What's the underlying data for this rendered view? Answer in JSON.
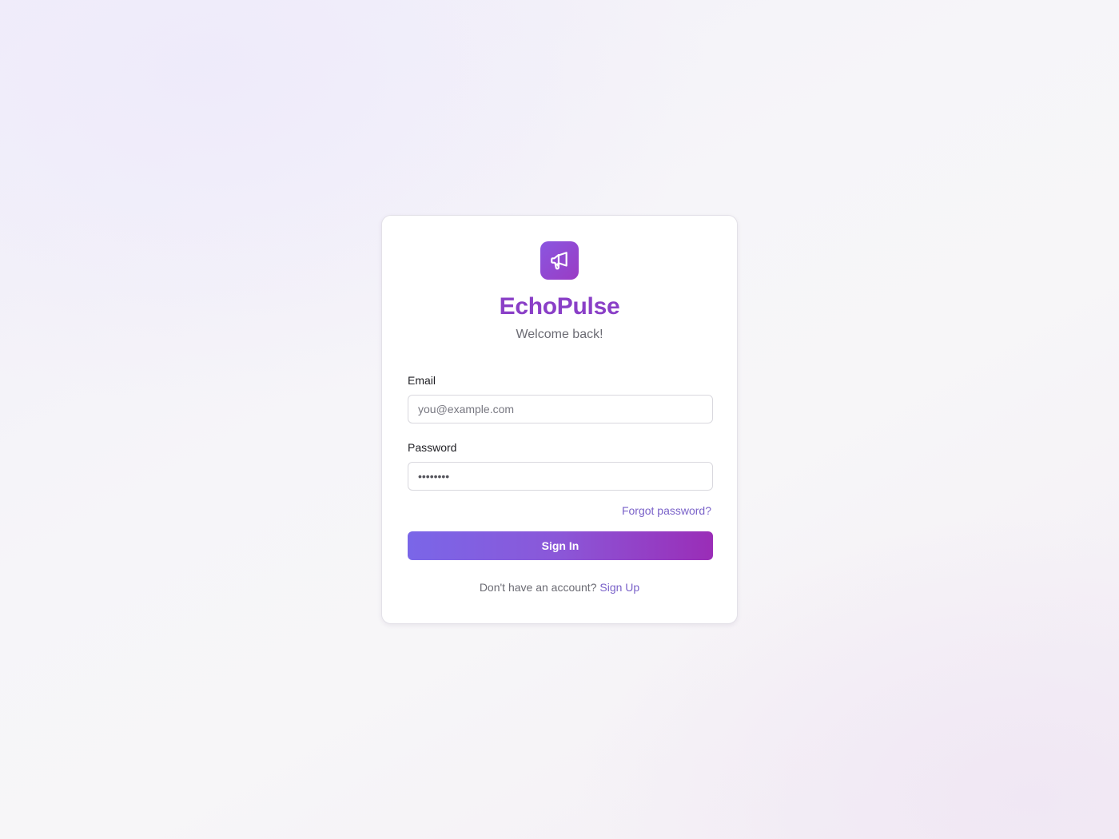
{
  "brand": {
    "name": "EchoPulse",
    "logo_icon": "megaphone-icon",
    "subtitle": "Welcome back!"
  },
  "form": {
    "email": {
      "label": "Email",
      "placeholder": "you@example.com",
      "value": ""
    },
    "password": {
      "label": "Password",
      "value": "••••••••"
    },
    "forgot_label": "Forgot password?",
    "submit_label": "Sign In"
  },
  "signup": {
    "prompt": "Don't have an account?",
    "link_label": "Sign Up"
  },
  "colors": {
    "brand": "#8a3fc7",
    "link": "#7a62c9",
    "button_start": "#7a66e8",
    "button_end": "#9a2db7"
  }
}
